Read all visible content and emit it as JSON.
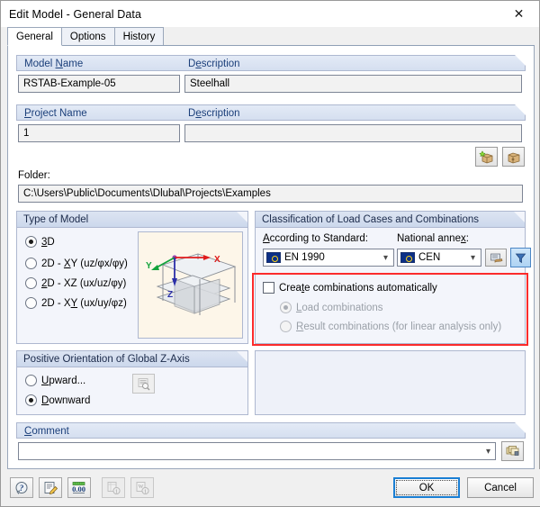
{
  "window": {
    "title": "Edit Model - General Data",
    "close_icon": "close-icon"
  },
  "tabs": [
    {
      "label": "General",
      "active": true
    },
    {
      "label": "Options",
      "active": false
    },
    {
      "label": "History",
      "active": false
    }
  ],
  "model_section": {
    "model_name_label": "Model Name",
    "model_name_accel": "N",
    "model_name_value": "RSTAB-Example-05",
    "description_label": "Description",
    "description_accel": "D",
    "description_value": "Steelhall"
  },
  "project_section": {
    "project_name_label": "Project Name",
    "project_name_accel": "P",
    "project_name_value": "1",
    "description_label": "Description",
    "description_accel": "D",
    "description_value": "",
    "new_project_button": "new-project-icon",
    "open_project_button": "open-project-icon",
    "folder_label": "Folder:",
    "folder_value": "C:\\Users\\Public\\Documents\\Dlubal\\Projects\\Examples"
  },
  "type_of_model": {
    "title": "Type of Model",
    "options": [
      {
        "label": "3D",
        "accel": "3",
        "selected": true
      },
      {
        "label": "2D - XY (uz/φx/φy)",
        "accel": "X",
        "selected": false
      },
      {
        "label": "2D - XZ (ux/uz/φy)",
        "accel": "2",
        "selected": false
      },
      {
        "label": "2D - XY (ux/uy/φz)",
        "accel": "Y",
        "selected": false
      }
    ],
    "preview": {
      "axis_x_label": "X",
      "axis_y_label": "Y",
      "axis_z_label": "Z",
      "axis_x_color": "#e01b1b",
      "axis_y_color": "#12a33c",
      "axis_z_color": "#2b2fa8",
      "background": "#fdf6e9"
    }
  },
  "classification": {
    "title": "Classification of Load Cases and Combinations",
    "standard_label": "According to Standard:",
    "standard_accel": "A",
    "standard_value": "EN 1990",
    "annex_label": "National annex:",
    "annex_accel": "x",
    "annex_value": "CEN",
    "settings_button": "annex-settings-icon",
    "filter_button": "filter-icon",
    "auto_combinations": {
      "label": "Create combinations automatically",
      "accel": "t",
      "checked": false,
      "options": [
        {
          "label": "Load combinations",
          "accel": "L",
          "selected": true,
          "disabled": true
        },
        {
          "label": "Result combinations (for linear analysis only)",
          "accel": "R",
          "selected": false,
          "disabled": true
        }
      ]
    },
    "highlight_color": "#fb2b2b"
  },
  "z_axis": {
    "title": "Positive Orientation of Global Z-Axis",
    "options": [
      {
        "label": "Upward...",
        "accel": "U",
        "selected": false
      },
      {
        "label": "Downward",
        "accel": "D",
        "selected": true
      }
    ],
    "preview_button": "document-zoom-icon"
  },
  "comment": {
    "label": "Comment",
    "accel": "C",
    "value": "",
    "dropdown_arrow": "chevron-down-icon",
    "pick_button": "comment-library-icon"
  },
  "footer": {
    "tools": [
      {
        "name": "help-icon",
        "disabled": false
      },
      {
        "name": "notes-edit-icon",
        "disabled": false
      },
      {
        "name": "units-icon",
        "label": "0.00",
        "disabled": false
      },
      {
        "name": "export-excel-icon",
        "disabled": true
      },
      {
        "name": "export-word-icon",
        "disabled": true
      }
    ],
    "ok_label": "OK",
    "cancel_label": "Cancel"
  }
}
